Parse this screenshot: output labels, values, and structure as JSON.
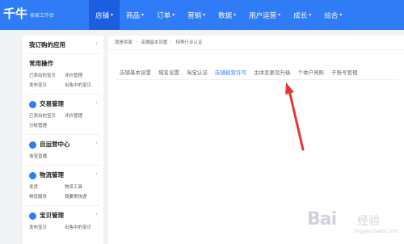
{
  "header": {
    "brand": "千牛",
    "subtitle": "卖家工作台",
    "nav": [
      {
        "label": "店铺",
        "active": true
      },
      {
        "label": "商品",
        "active": false
      },
      {
        "label": "订单",
        "active": false
      },
      {
        "label": "营销",
        "active": false
      },
      {
        "label": "数据",
        "active": false
      },
      {
        "label": "用户运营",
        "active": false
      },
      {
        "label": "成长",
        "active": false
      },
      {
        "label": "综合",
        "active": false
      }
    ]
  },
  "sidebar": {
    "my_apps": "我订购的应用",
    "common": {
      "title": "常用操作",
      "links": [
        "已卖出的宝贝",
        "评价管理",
        "发布宝贝",
        "出售中的宝贝"
      ]
    },
    "trade": {
      "title": "交易管理",
      "links": [
        "已卖出的宝贝",
        "评价管理",
        "分帐管理"
      ]
    },
    "self_op": {
      "title": "自运营中心",
      "links": [
        "淘宝直播"
      ]
    },
    "logistics": {
      "title": "物流管理",
      "links": [
        "发货",
        "物流工具",
        "物流服务",
        "我要寄快递"
      ]
    },
    "items": {
      "title": "宝贝管理",
      "links": [
        "发布宝贝",
        "出售中的宝贝"
      ]
    }
  },
  "breadcrumb": [
    "我是卖家",
    "店铺基本设置",
    "特殊行业认证"
  ],
  "tabs": [
    {
      "label": "店铺基本设置",
      "active": false
    },
    {
      "label": "域名设置",
      "active": false
    },
    {
      "label": "淘宝认证",
      "active": false
    },
    {
      "label": "店铺经营许可",
      "active": true
    },
    {
      "label": "主体变更及升级",
      "active": false
    },
    {
      "label": "个体户亮照",
      "active": false
    },
    {
      "label": "子账号管理",
      "active": false
    }
  ],
  "watermark": {
    "logo": "Bai",
    "cn": "经验",
    "sub": "jingyan.baidu.com"
  },
  "colors": {
    "header": "#2f7cf6",
    "active_nav": "#1b5fe0",
    "arrow": "#e53935"
  }
}
